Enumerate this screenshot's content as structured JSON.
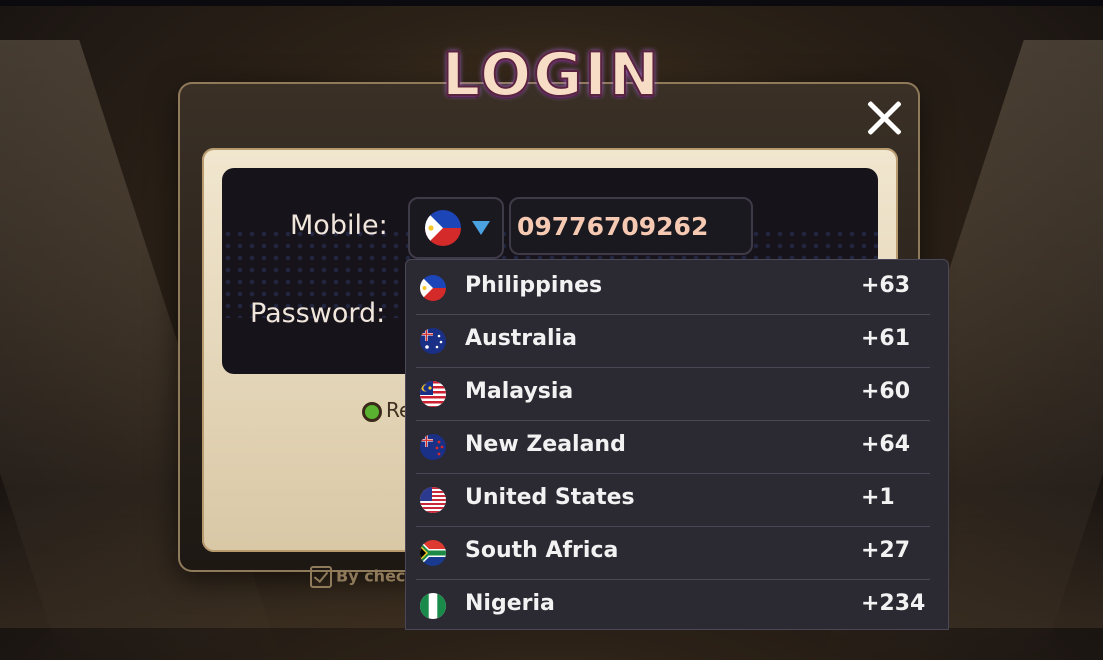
{
  "dialog": {
    "title": "LOGIN",
    "close_icon": "close-icon"
  },
  "form": {
    "mobile_label": "Mobile:",
    "password_label": "Password:",
    "phone_value": "09776709262",
    "selected_country_flag": "philippines-flag-icon",
    "remember_label": "Re",
    "terms_label": "By check"
  },
  "country_dropdown": {
    "options": [
      {
        "name": "Philippines",
        "code": "+63",
        "flag": "philippines-flag-icon"
      },
      {
        "name": "Australia",
        "code": "+61",
        "flag": "australia-flag-icon"
      },
      {
        "name": "Malaysia",
        "code": "+60",
        "flag": "malaysia-flag-icon"
      },
      {
        "name": "New Zealand",
        "code": "+64",
        "flag": "new-zealand-flag-icon"
      },
      {
        "name": "United States",
        "code": "+1",
        "flag": "united-states-flag-icon"
      },
      {
        "name": "South Africa",
        "code": "+27",
        "flag": "south-africa-flag-icon"
      },
      {
        "name": "Nigeria",
        "code": "+234",
        "flag": "nigeria-flag-icon"
      }
    ]
  },
  "colors": {
    "accent_caret": "#4aa2e0",
    "phone_text": "#f6c9b2",
    "dropdown_bg": "#2b2a33"
  }
}
